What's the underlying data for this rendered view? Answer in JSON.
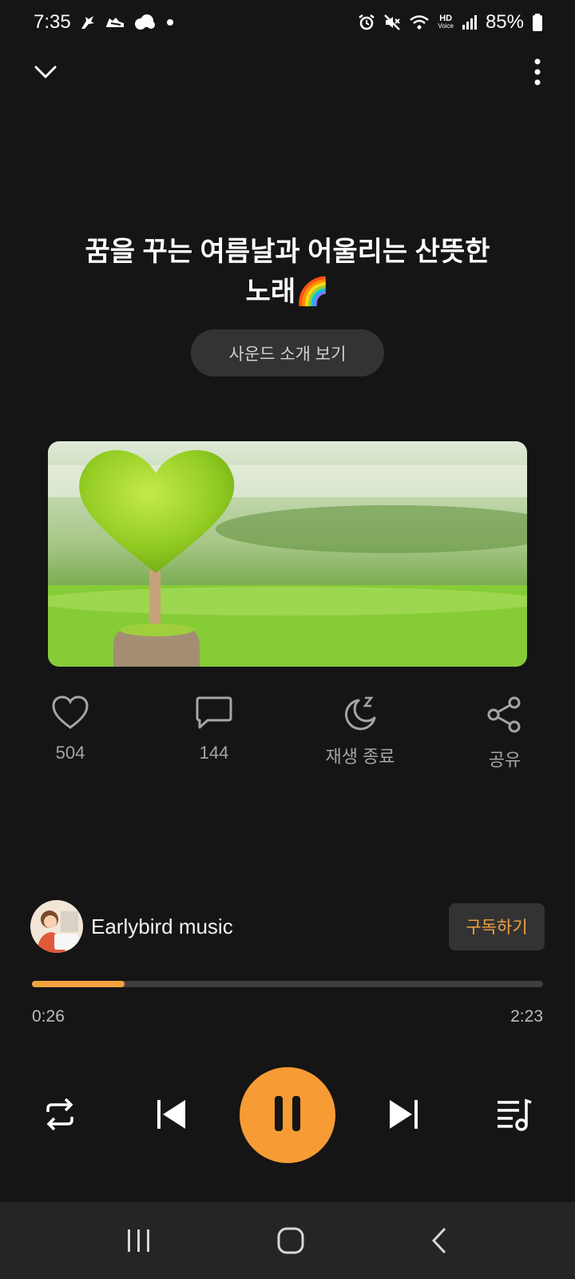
{
  "status_bar": {
    "time": "7:35",
    "battery": "85%",
    "hd_label": "HD",
    "voice_label": "Voice",
    "icons": [
      "bird-icon",
      "sneaker-icon",
      "cloud-icon",
      "alarm-icon",
      "mute-icon",
      "wifi-icon",
      "signal-icon",
      "battery-icon"
    ]
  },
  "header": {
    "icons": [
      "chevron-down-icon",
      "more-vertical-icon"
    ]
  },
  "sound": {
    "title_line1": "꿈을 꾸는 여름날과 어울리는 산뜻한",
    "title_line2": "노래🌈",
    "intro_button": "사운드 소개 보기",
    "cover_image": "heart-shaped-topiary-on-grass"
  },
  "actions": {
    "like": {
      "icon": "heart-icon",
      "label": "504"
    },
    "comment": {
      "icon": "comment-icon",
      "label": "144"
    },
    "sleep": {
      "icon": "moon-sleep-icon",
      "label": "재생 종료"
    },
    "share": {
      "icon": "share-icon",
      "label": "공유"
    }
  },
  "channel": {
    "name": "Earlybird music",
    "subscribe_label": "구독하기",
    "avatar": "girl-reading-illustration"
  },
  "player": {
    "current_time": "0:26",
    "total_time": "2:23",
    "progress": 0.182,
    "accent_color": "#f79b35",
    "controls": [
      "repeat-icon",
      "previous-icon",
      "pause-icon",
      "next-icon",
      "playlist-icon"
    ]
  },
  "nav_bar": {
    "buttons": [
      "recent-apps-icon",
      "home-icon",
      "back-icon"
    ]
  }
}
